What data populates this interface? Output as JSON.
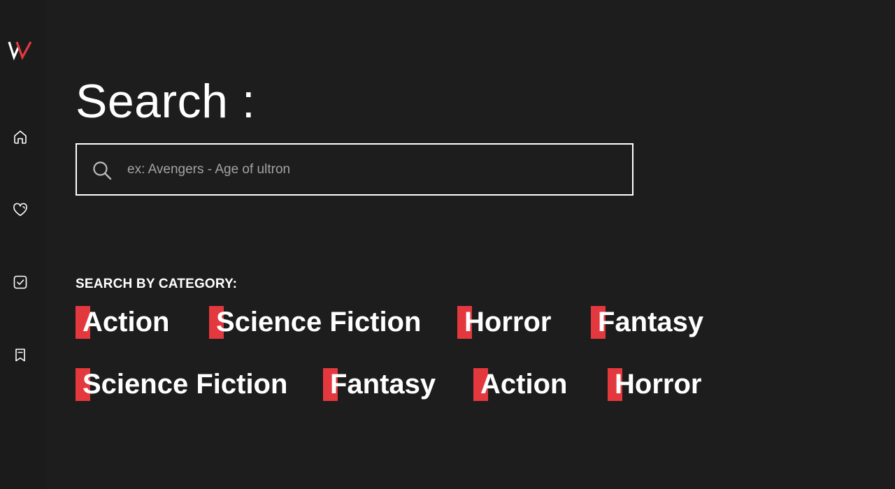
{
  "app": {
    "logo_text": "W",
    "accent_color": "#e4383f",
    "background_color": "#1d1d1d"
  },
  "sidebar": {
    "items": [
      {
        "name": "home",
        "icon": "home-icon"
      },
      {
        "name": "favorites",
        "icon": "heart-icon"
      },
      {
        "name": "watched",
        "icon": "checkbox-icon"
      },
      {
        "name": "watchlist",
        "icon": "bookmark-icon"
      }
    ]
  },
  "search": {
    "title": "Search :",
    "icon": "search-icon",
    "placeholder": "ex: Avengers - Age of ultron",
    "value": ""
  },
  "categories": {
    "heading": "SEARCH BY CATEGORY:",
    "rows": [
      [
        "Action",
        "Science Fiction",
        "Horror",
        "Fantasy"
      ],
      [
        "Science Fiction",
        "Fantasy",
        "Action",
        "Horror"
      ]
    ]
  }
}
